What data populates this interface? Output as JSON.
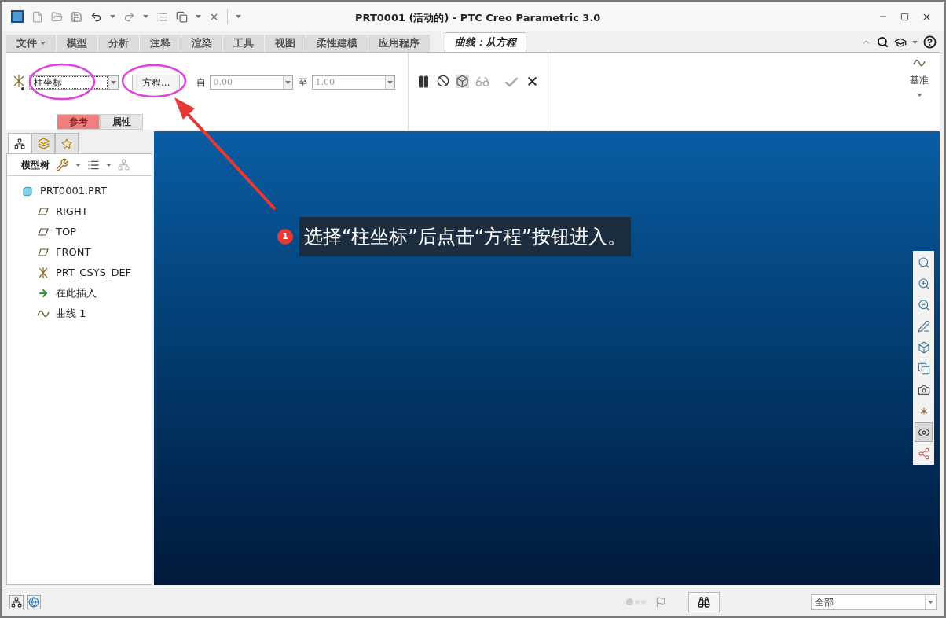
{
  "window": {
    "title": "PRT0001 (活动的) - PTC Creo Parametric 3.0"
  },
  "tabs": [
    {
      "label": "文件",
      "kind": "menu",
      "selected": false
    },
    {
      "label": "模型",
      "kind": "tab",
      "selected": false
    },
    {
      "label": "分析",
      "kind": "tab",
      "selected": false
    },
    {
      "label": "注释",
      "kind": "tab",
      "selected": false
    },
    {
      "label": "渲染",
      "kind": "tab",
      "selected": false
    },
    {
      "label": "工具",
      "kind": "tab",
      "selected": false
    },
    {
      "label": "视图",
      "kind": "tab",
      "selected": false
    },
    {
      "label": "柔性建模",
      "kind": "tab",
      "selected": false
    },
    {
      "label": "应用程序",
      "kind": "tab",
      "selected": false
    },
    {
      "label": "曲线：从方程",
      "kind": "tab",
      "selected": true
    }
  ],
  "ribbon": {
    "csys_type": {
      "value": "柱坐标"
    },
    "equation_button": "方程...",
    "from": {
      "label": "自",
      "value": "0.00"
    },
    "to": {
      "label": "至",
      "value": "1.00"
    },
    "subtabs": [
      {
        "label": "参考",
        "selected": true
      },
      {
        "label": "属性",
        "selected": false
      }
    ],
    "datum": {
      "label": "基准"
    }
  },
  "panel_tabs": [
    {
      "kind": "tree",
      "selected": true
    },
    {
      "kind": "folders",
      "selected": false
    },
    {
      "kind": "favorites",
      "selected": false
    }
  ],
  "model_tree": {
    "title": "模型树",
    "items": [
      {
        "label": "PRT0001.PRT",
        "kind": "part",
        "children": [
          {
            "label": "RIGHT",
            "kind": "plane"
          },
          {
            "label": "TOP",
            "kind": "plane"
          },
          {
            "label": "FRONT",
            "kind": "plane"
          },
          {
            "label": "PRT_CSYS_DEF",
            "kind": "csys"
          },
          {
            "label": "在此插入",
            "kind": "insert"
          },
          {
            "label": "曲线 1",
            "kind": "curve"
          }
        ]
      }
    ]
  },
  "view_tools": [
    {
      "kind": "refit",
      "on": false
    },
    {
      "kind": "zoom-in",
      "on": false
    },
    {
      "kind": "zoom-out",
      "on": false
    },
    {
      "kind": "repaint",
      "on": false
    },
    {
      "kind": "display-style",
      "on": false
    },
    {
      "kind": "saved-views",
      "on": false
    },
    {
      "kind": "view-manager",
      "on": false
    },
    {
      "kind": "datum-display",
      "on": false
    },
    {
      "kind": "annotation-display",
      "on": true
    },
    {
      "kind": "spin-center",
      "on": false
    }
  ],
  "callout": {
    "number": "1",
    "text": "选择“柱坐标”后点击“方程”按钮进入。"
  },
  "status_bar": {
    "filter": "全部"
  }
}
